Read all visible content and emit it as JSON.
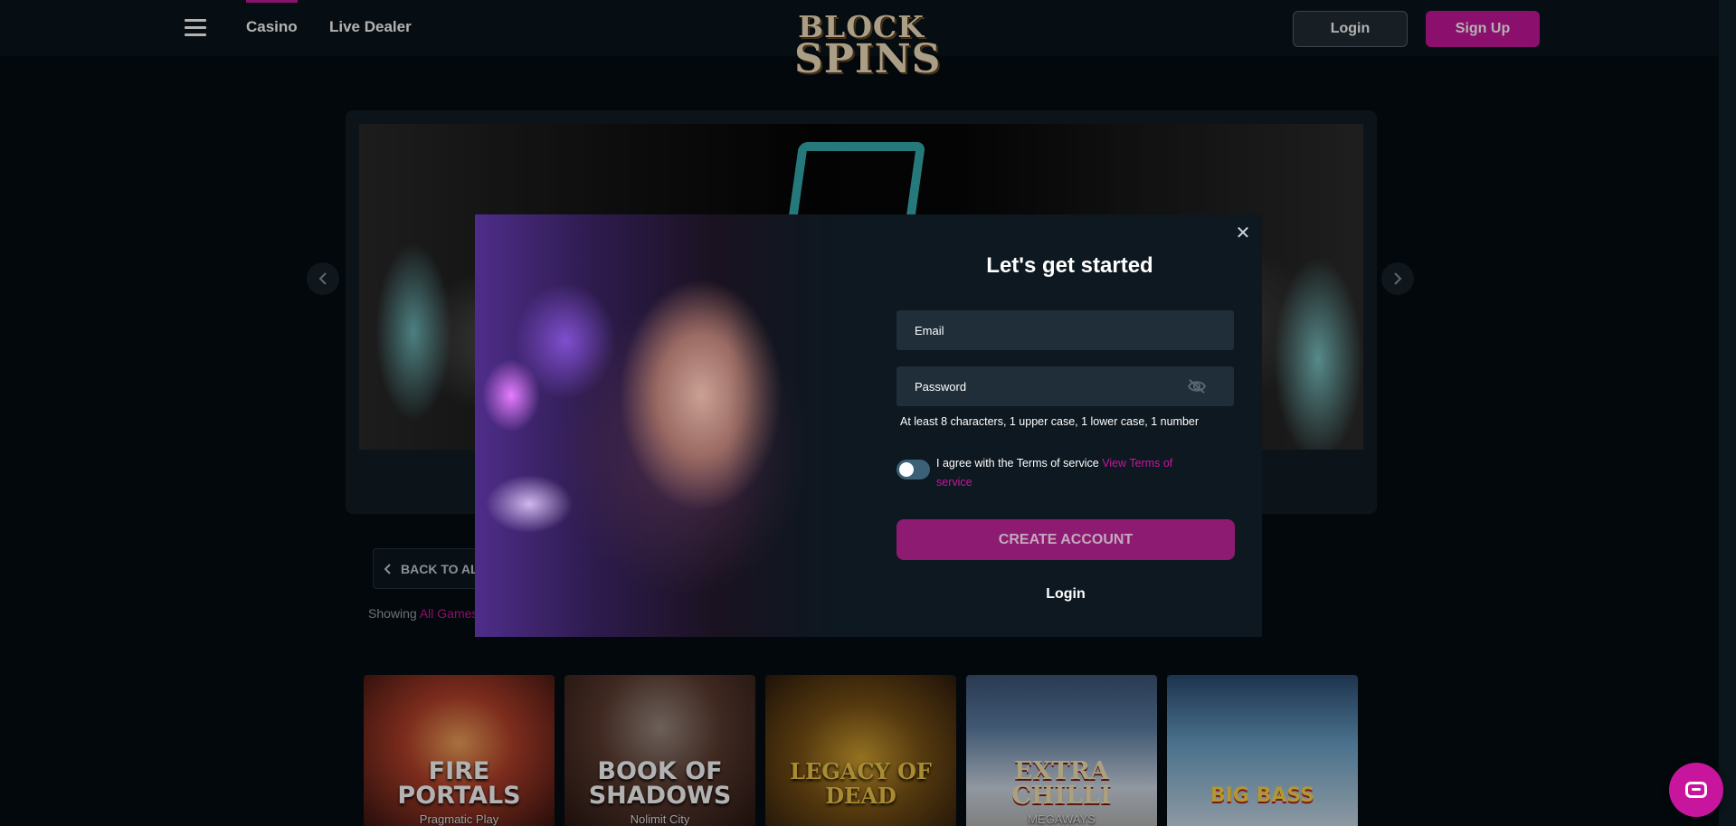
{
  "header": {
    "nav": [
      "Casino",
      "Live Dealer"
    ],
    "logo_line1": "BLOCK",
    "logo_line2": "SPINS",
    "login_label": "Login",
    "signup_label": "Sign Up"
  },
  "hero": {
    "prev_icon": "chevron-left-icon",
    "next_icon": "chevron-right-icon"
  },
  "games_bar": {
    "back_label": "BACK TO ALL",
    "showing_prefix": "Showing",
    "showing_highlight": "All Games"
  },
  "games": [
    {
      "title": "FIRE PORTALS",
      "provider": "Pragmatic Play"
    },
    {
      "title": "BOOK OF SHADOWS",
      "provider": "Nolimit City"
    },
    {
      "title": "LEGACY OF DEAD",
      "provider": ""
    },
    {
      "title": "EXTRA CHILLI",
      "provider": "MEGAWAYS"
    },
    {
      "title": "BIG BASS",
      "provider": ""
    }
  ],
  "modal": {
    "title": "Let's get started",
    "email_placeholder": "Email",
    "password_placeholder": "Password",
    "password_hint": "At least 8 characters, 1 upper case, 1 lower case, 1 number",
    "terms_text": "I agree with the Terms of service",
    "terms_link": "View Terms of service",
    "create_label": "CREATE ACCOUNT",
    "login_label": "Login",
    "close_glyph": "✕"
  },
  "colors": {
    "accent": "#c7169d",
    "create_button": "#8d1b72",
    "background": "#050c12"
  }
}
